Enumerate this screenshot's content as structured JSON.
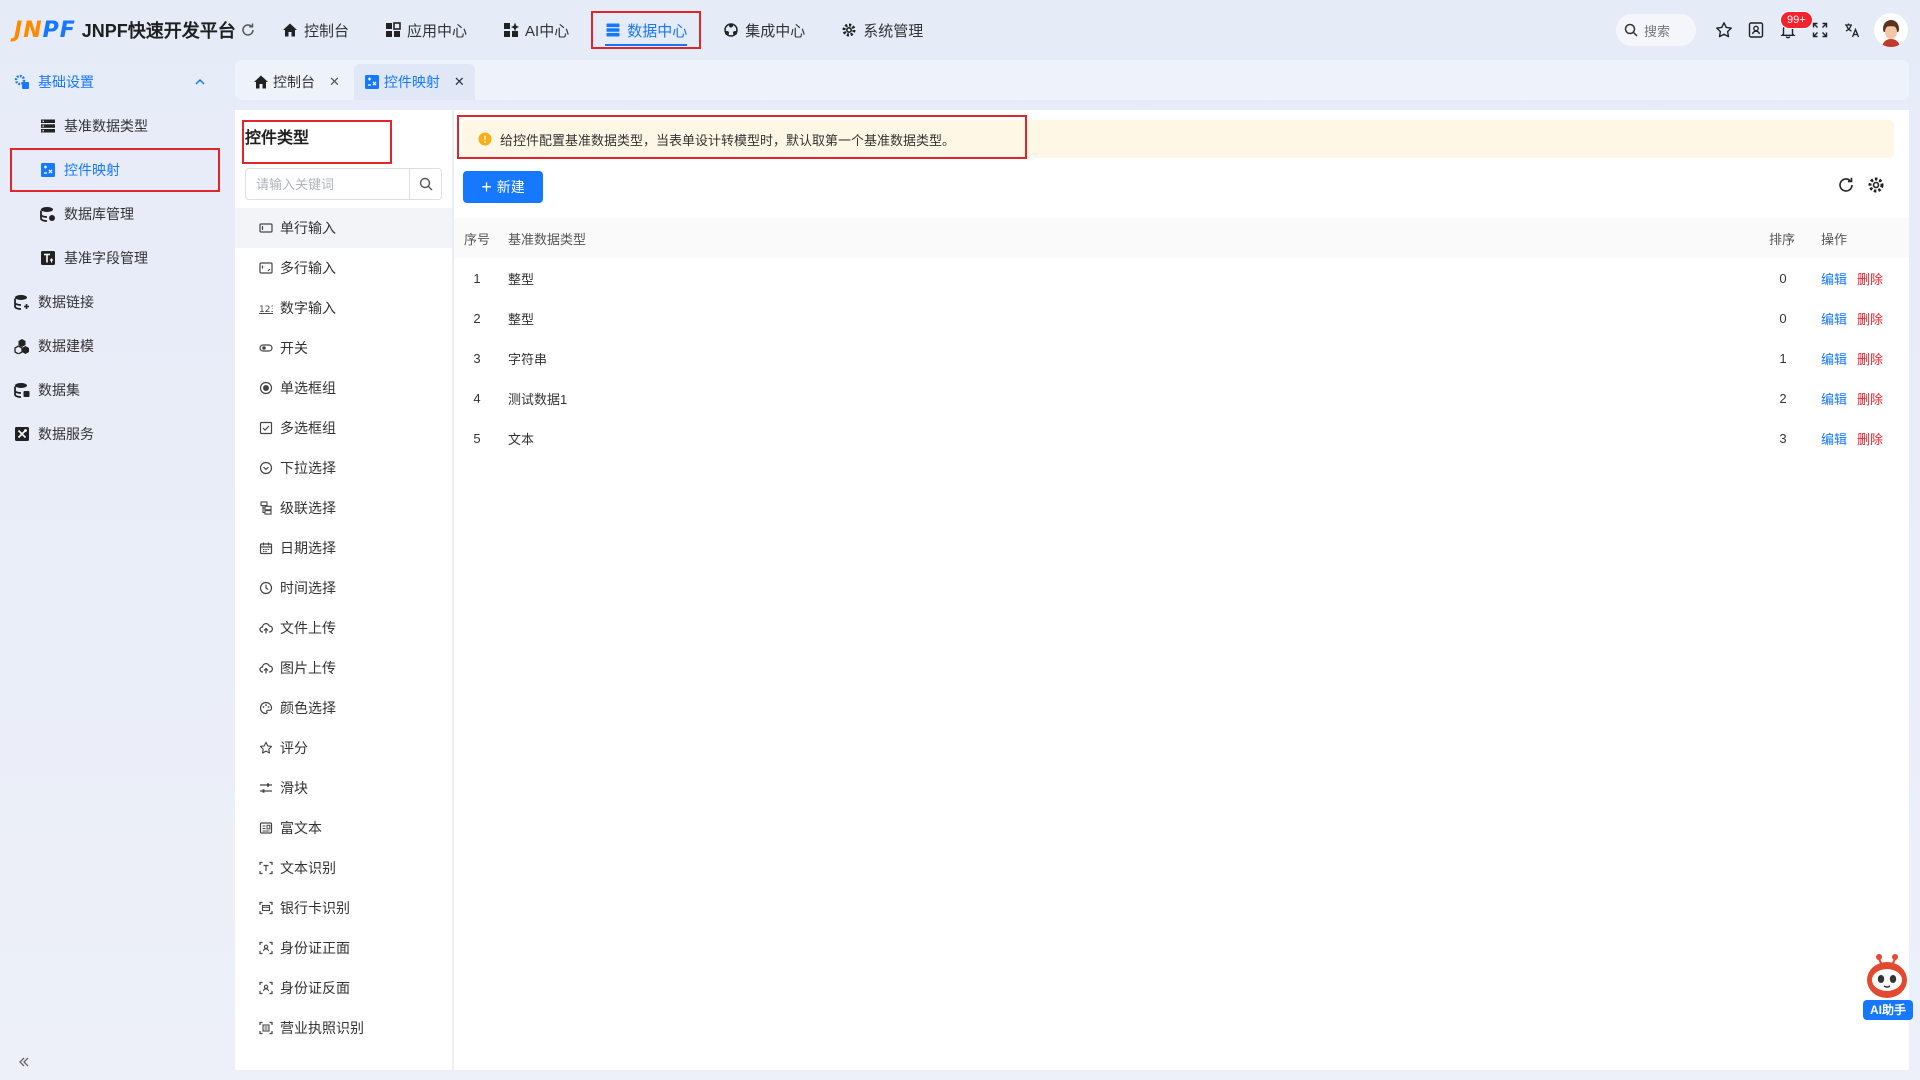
{
  "app": {
    "logo_mark_a": "J",
    "logo_mark_b": "N",
    "logo_mark_c": "PF",
    "title": "JNPF快速开发平台"
  },
  "topnav": [
    {
      "label": "控制台",
      "icon": "home-icon"
    },
    {
      "label": "应用中心",
      "icon": "grid-icon"
    },
    {
      "label": "AI中心",
      "icon": "ai-grid-icon"
    },
    {
      "label": "数据中心",
      "icon": "database-icon",
      "active": true
    },
    {
      "label": "集成中心",
      "icon": "integration-icon"
    },
    {
      "label": "系统管理",
      "icon": "gear-icon"
    }
  ],
  "toolbar": {
    "search_placeholder": "搜索",
    "notification_count": "99+"
  },
  "sidebar": {
    "group": {
      "label": "基础设置",
      "expanded": true
    },
    "sub_items": [
      {
        "label": "基准数据类型"
      },
      {
        "label": "控件映射",
        "active": true
      },
      {
        "label": "数据库管理"
      },
      {
        "label": "基准字段管理"
      }
    ],
    "top_items": [
      {
        "label": "数据链接"
      },
      {
        "label": "数据建模"
      },
      {
        "label": "数据集"
      },
      {
        "label": "数据服务"
      }
    ]
  },
  "tabs": [
    {
      "label": "控制台",
      "icon": "home-icon"
    },
    {
      "label": "控件映射",
      "icon": "control-map-icon",
      "active": true
    }
  ],
  "left_panel": {
    "title": "控件类型",
    "search_placeholder": "请输入关键词",
    "items": [
      "单行输入",
      "多行输入",
      "数字输入",
      "开关",
      "单选框组",
      "多选框组",
      "下拉选择",
      "级联选择",
      "日期选择",
      "时间选择",
      "文件上传",
      "图片上传",
      "颜色选择",
      "评分",
      "滑块",
      "富文本",
      "文本识别",
      "银行卡识别",
      "身份证正面",
      "身份证反面",
      "营业执照识别"
    ]
  },
  "main": {
    "alert": "给控件配置基准数据类型，当表单设计转模型时，默认取第一个基准数据类型。",
    "new_button": "新建",
    "columns": {
      "index": "序号",
      "type": "基准数据类型",
      "sort": "排序",
      "ops": "操作"
    },
    "rows": [
      {
        "index": "1",
        "type": "整型",
        "sort": "0"
      },
      {
        "index": "2",
        "type": "整型",
        "sort": "0"
      },
      {
        "index": "3",
        "type": "字符串",
        "sort": "1"
      },
      {
        "index": "4",
        "type": "测试数据1",
        "sort": "2"
      },
      {
        "index": "5",
        "type": "文本",
        "sort": "3"
      }
    ],
    "edit_label": "编辑",
    "delete_label": "删除"
  },
  "ai_helper": {
    "label": "AI助手"
  },
  "colors": {
    "primary": "#1677ff",
    "danger": "#f5222d",
    "highlight_box": "#e0262a",
    "alert_bg": "#fff7e6"
  }
}
